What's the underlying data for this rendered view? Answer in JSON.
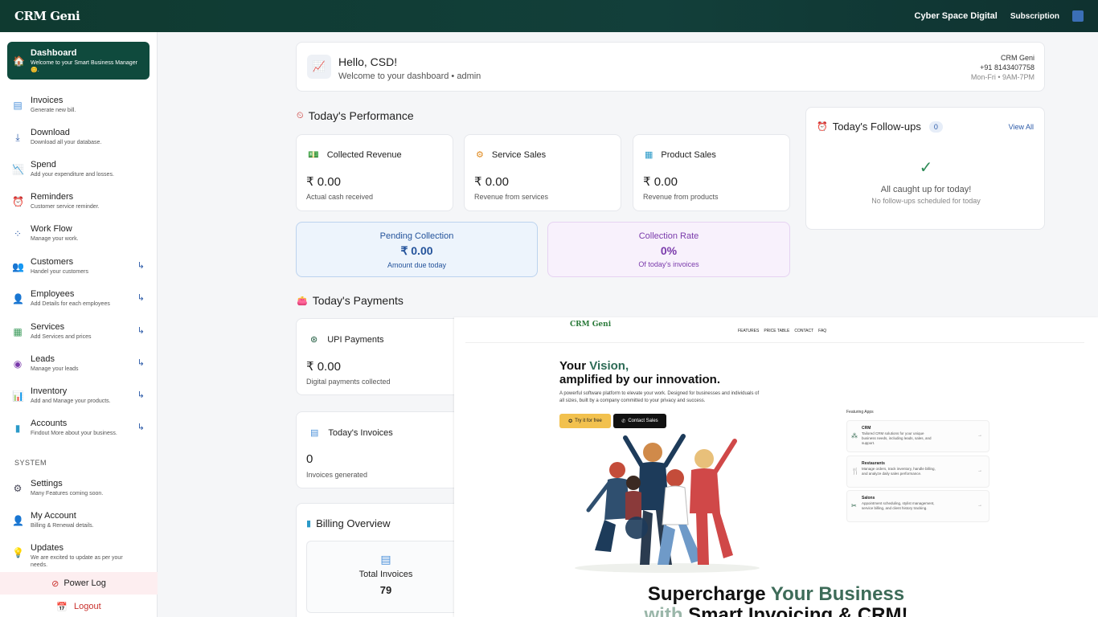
{
  "topbar": {
    "logo": "CRM Geni",
    "company": "Cyber Space Digital",
    "subscription": "Subscription"
  },
  "sidebar": {
    "dashboard": {
      "title": "Dashboard",
      "subtitle": "Welcome to your Smart Business Manager 😊."
    },
    "items": [
      {
        "title": "Invoices",
        "subtitle": "Generate new bill."
      },
      {
        "title": "Download",
        "subtitle": "Download all your database."
      },
      {
        "title": "Spend",
        "subtitle": "Add your expenditure and losses."
      },
      {
        "title": "Reminders",
        "subtitle": "Customer service reminder."
      },
      {
        "title": "Work Flow",
        "subtitle": "Manage your work."
      },
      {
        "title": "Customers",
        "subtitle": "Handel your customers"
      },
      {
        "title": "Employees",
        "subtitle": "Add Details for each employees"
      },
      {
        "title": "Services",
        "subtitle": "Add Services and prices"
      },
      {
        "title": "Leads",
        "subtitle": "Manage your leads"
      },
      {
        "title": "Inventory",
        "subtitle": "Add and Manage your products."
      },
      {
        "title": "Accounts",
        "subtitle": "Findout More about your business."
      }
    ],
    "system_label": "SYSTEM",
    "system_items": [
      {
        "title": "Settings",
        "subtitle": "Many Features coming soon."
      },
      {
        "title": "My Account",
        "subtitle": "Billing & Renewal details."
      },
      {
        "title": "Updates",
        "subtitle": "We are excited to update as per your needs."
      }
    ],
    "power_log": "Power Log",
    "logout": "Logout"
  },
  "hello": {
    "greeting": "Hello, CSD!",
    "subtitle": "Welcome to your dashboard • admin",
    "org": "CRM Geni",
    "phone": "+91 8143407758",
    "hours": "Mon-Fri • 9AM-7PM"
  },
  "performance": {
    "title": "Today's Performance",
    "cards": [
      {
        "title": "Collected Revenue",
        "amount": "₹ 0.00",
        "label": "Actual cash received"
      },
      {
        "title": "Service Sales",
        "amount": "₹ 0.00",
        "label": "Revenue from services"
      },
      {
        "title": "Product Sales",
        "amount": "₹ 0.00",
        "label": "Revenue from products"
      }
    ],
    "pending": {
      "title": "Pending Collection",
      "value": "₹ 0.00",
      "label": "Amount due today"
    },
    "rate": {
      "title": "Collection Rate",
      "value": "0%",
      "label": "Of today's invoices"
    }
  },
  "followups": {
    "title": "Today's Follow-ups",
    "count": "0",
    "view_all": "View All",
    "msg1": "All caught up for today!",
    "msg2": "No follow-ups scheduled for today"
  },
  "payments": {
    "title": "Today's Payments",
    "upi": {
      "title": "UPI Payments",
      "amount": "₹ 0.00",
      "label": "Digital payments collected"
    },
    "invoices": {
      "title": "Today's Invoices",
      "amount": "0",
      "label": "Invoices generated"
    }
  },
  "billing": {
    "title": "Billing Overview",
    "total_label": "Total Invoices",
    "total_value": "79"
  },
  "overlay": {
    "logo": "CRM Geni",
    "nav": [
      "FEATURES",
      "PRICE TABLE",
      "CONTACT",
      "FAQ"
    ],
    "headline_a": "Your ",
    "headline_b": "Vision,",
    "headline_c": "amplified by our innovation.",
    "para": "A powerful software platform to elevate your work. Designed for businesses and individuals of all sizes, built by a company committed to your privacy and success.",
    "btn_try": "Try it for free",
    "btn_contact": "Contact Sales",
    "featuring": "Featuring Apps",
    "apps": [
      {
        "name": "CRM",
        "desc": "Tailored CRM solutions for your unique business needs, including leads, sales, and support."
      },
      {
        "name": "Restaurants",
        "desc": "Manage orders, track inventory, handle billing, and analyze daily sales performance."
      },
      {
        "name": "Salons",
        "desc": "Appointment scheduling, stylist management, service billing, and client history tracking."
      }
    ],
    "big1a": "Supercharge ",
    "big1b": "Your Business",
    "big2a": "with ",
    "big2b": "Smart Invoicing & CRM!"
  }
}
